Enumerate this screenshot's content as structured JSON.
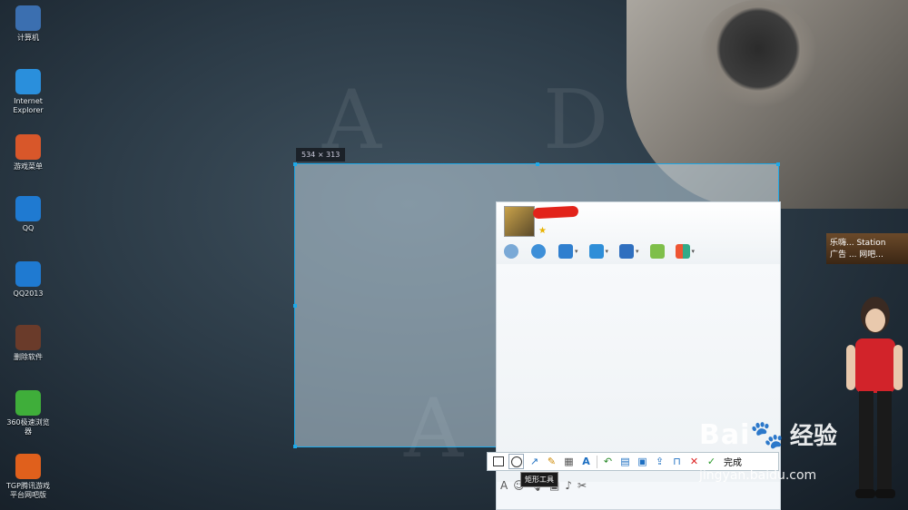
{
  "desktop": {
    "icons": [
      {
        "label": "计算机",
        "color": "#3b6fb0"
      },
      {
        "label": "Internet\nExplorer",
        "color": "#2a8fdc"
      },
      {
        "label": "游戏菜单",
        "color": "#d8572a"
      },
      {
        "label": "QQ",
        "color": "#1f7ad1"
      },
      {
        "label": "QQ2013",
        "color": "#1f7ad1"
      },
      {
        "label": "删除软件",
        "color": "#6a3b2a"
      },
      {
        "label": "360极速浏览\n器",
        "color": "#3fae3a"
      },
      {
        "label": "TGP腾讯游戏\n平台网吧版",
        "color": "#e0601c"
      }
    ]
  },
  "capture": {
    "size_label": "534 × 313"
  },
  "qq_window": {
    "toolbar_icons": [
      "microphone-icon",
      "video-icon",
      "screen-share-icon",
      "folder-icon",
      "remote-desktop-icon",
      "message-add-icon",
      "app-grid-icon"
    ]
  },
  "banner": {
    "line1": "乐嗨... Station",
    "line2": "广告 ... 网吧..."
  },
  "screenshot_toolbar": {
    "tools": [
      "rectangle",
      "ellipse",
      "arrow",
      "pen",
      "mosaic",
      "text",
      "undo",
      "save",
      "copy",
      "share",
      "pin",
      "cancel",
      "confirm"
    ],
    "done_label": "完成",
    "tooltip": "矩形工具"
  },
  "watermark": {
    "brand": "Bai",
    "brand_tail": "经验",
    "url": "jingyan.baidu.com"
  },
  "colors": {
    "selection": "#1ea9e8",
    "accent_red": "#e2231a"
  }
}
